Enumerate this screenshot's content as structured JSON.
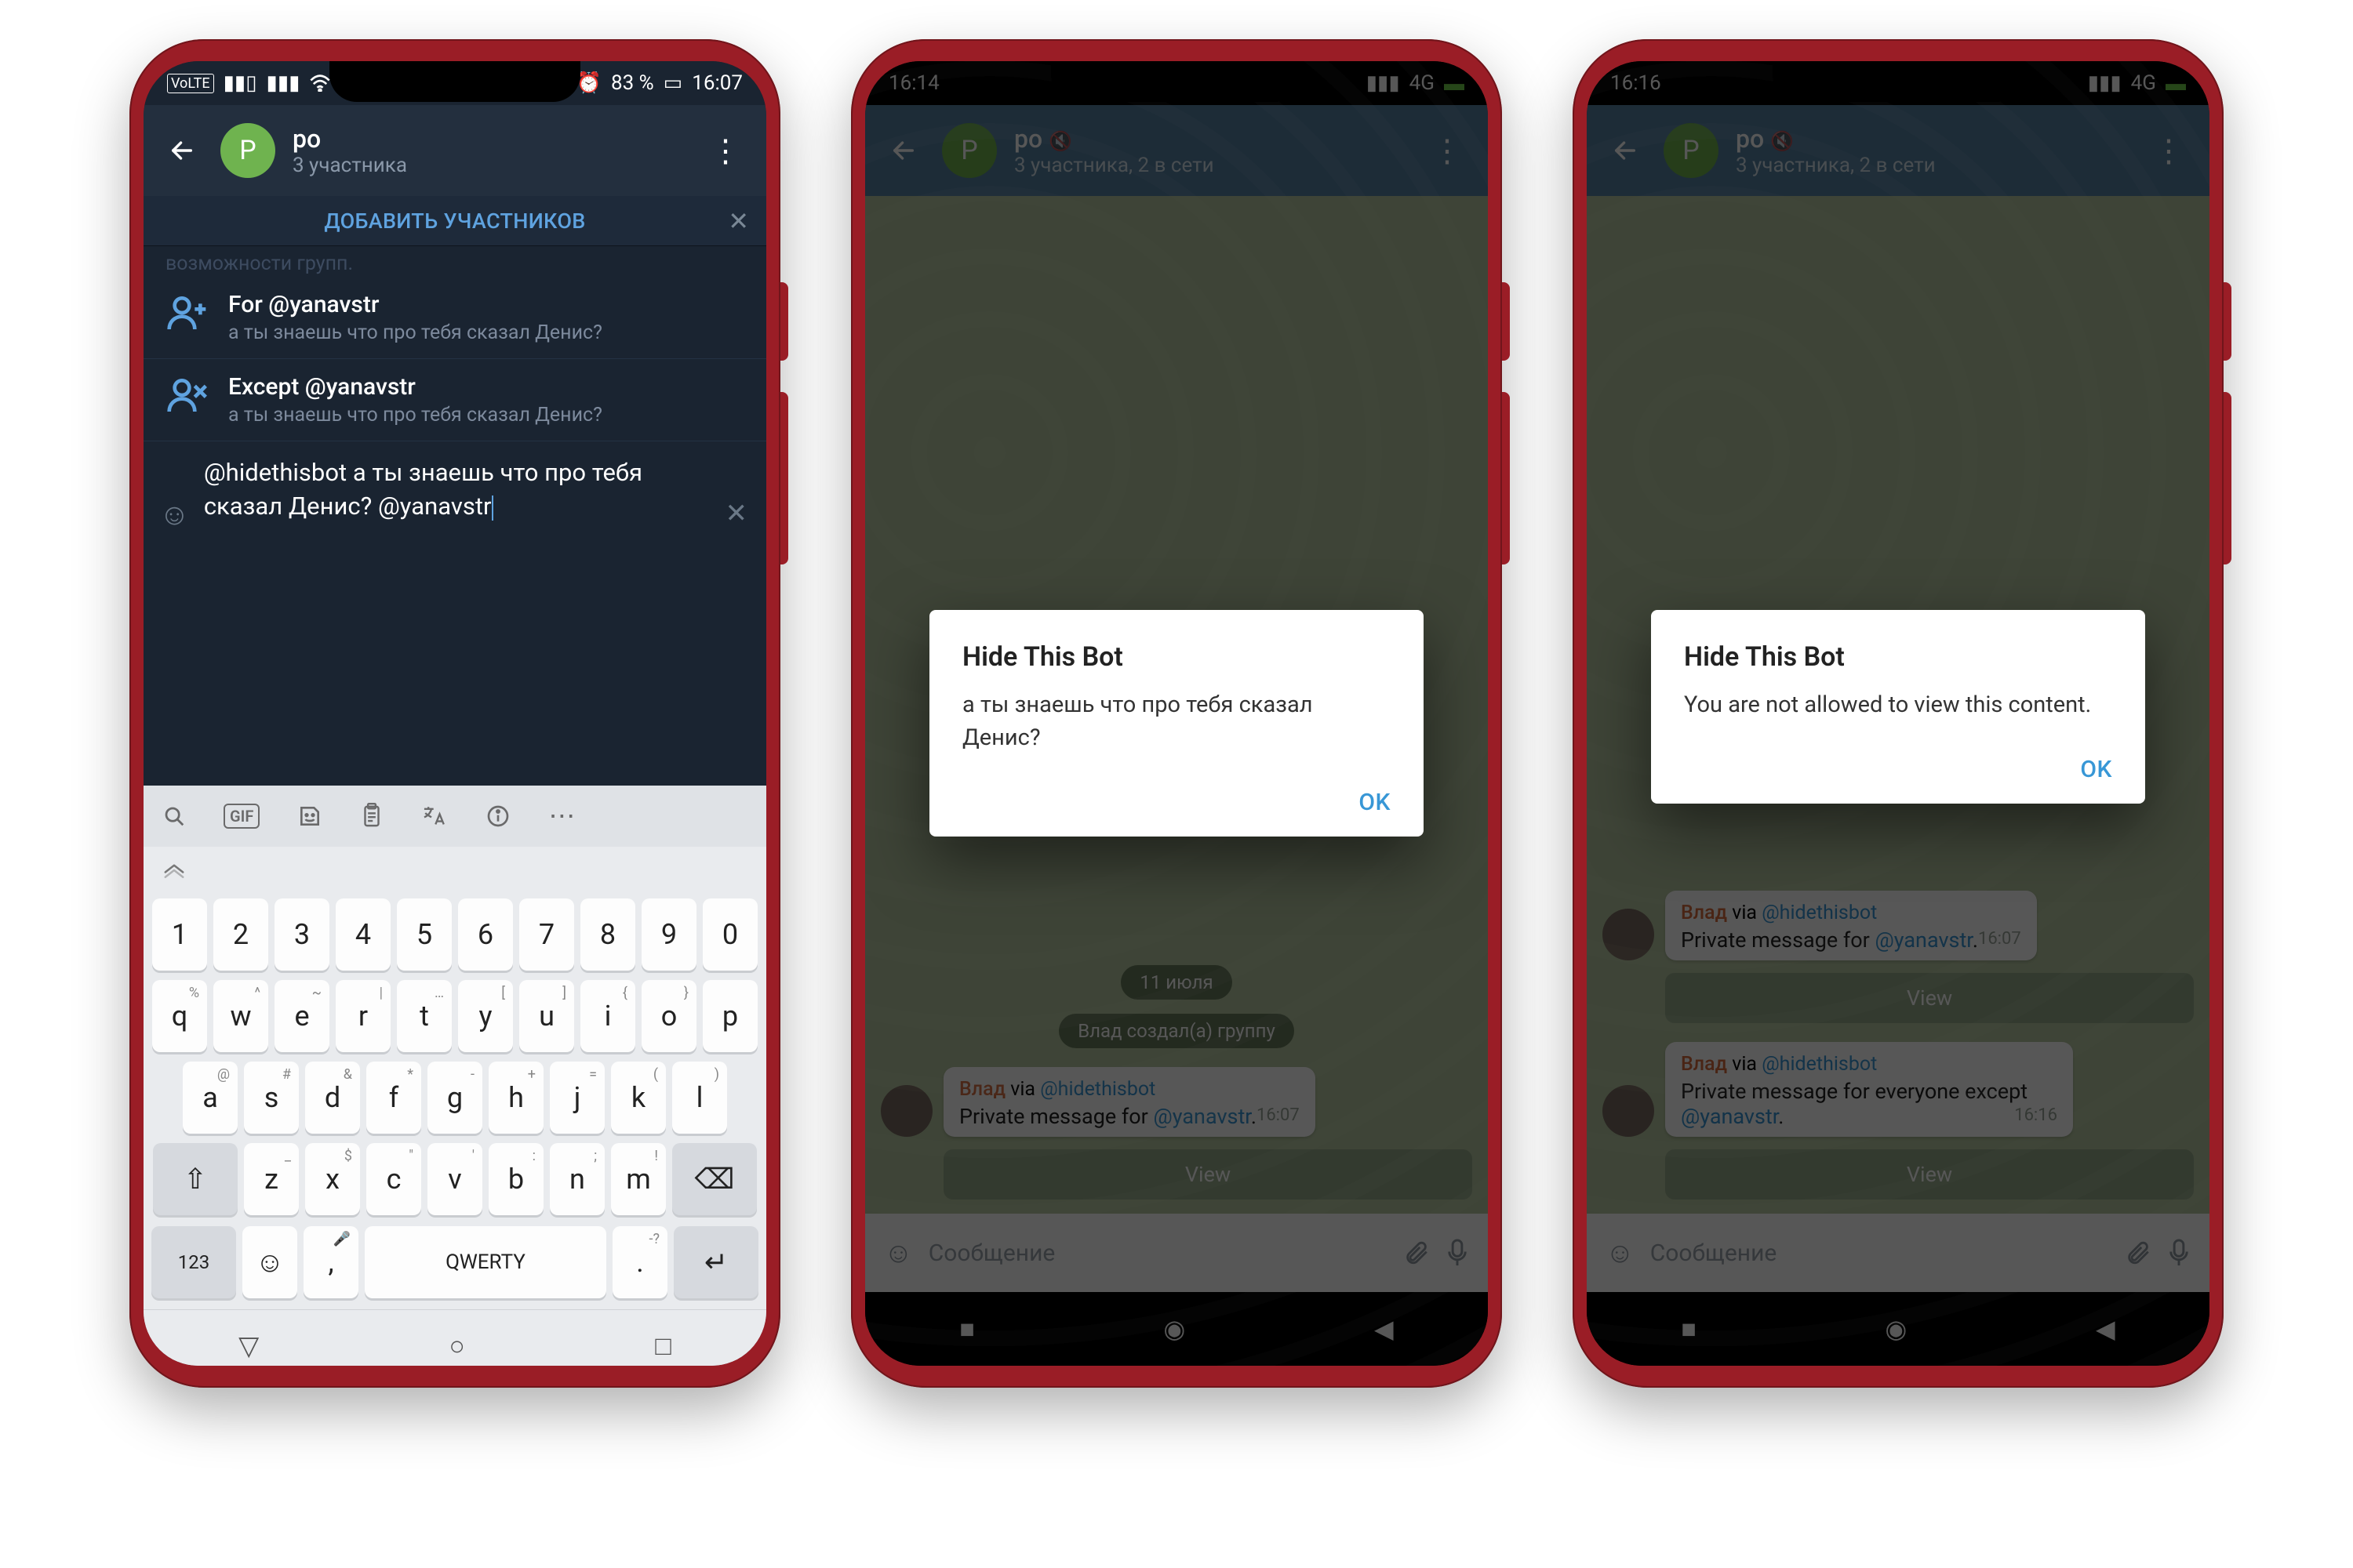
{
  "screen1": {
    "status": {
      "battery": "83 %",
      "time": "16:07"
    },
    "header": {
      "avatar_letter": "P",
      "title": "po",
      "subtitle": "3 участника"
    },
    "banner": {
      "text": "ДОБАВИТЬ УЧАСТНИКОВ"
    },
    "faded": "возможности групп.",
    "suggest": [
      {
        "title": "For @yanavstr",
        "sub": "а ты знаешь что про тебя сказал Денис?"
      },
      {
        "title": "Except @yanavstr",
        "sub": "а ты знаешь что про тебя сказал Денис?"
      }
    ],
    "input_text": "@hidethisbot а ты знаешь что про тебя сказал Денис? @yanavstr",
    "keyboard": {
      "row1": [
        "1",
        "2",
        "3",
        "4",
        "5",
        "6",
        "7",
        "8",
        "9",
        "0"
      ],
      "row2": [
        "q",
        "w",
        "e",
        "r",
        "t",
        "y",
        "u",
        "i",
        "o",
        "p"
      ],
      "row2sup": [
        "%",
        "^",
        "~",
        "|",
        "…",
        "[",
        "]",
        "{",
        "}",
        ""
      ],
      "row3": [
        "a",
        "s",
        "d",
        "f",
        "g",
        "h",
        "j",
        "k",
        "l"
      ],
      "row3sup": [
        "@",
        "#",
        "&",
        "*",
        "-",
        "+",
        "=",
        "(",
        ")"
      ],
      "row4": [
        "z",
        "x",
        "c",
        "v",
        "b",
        "n",
        "m"
      ],
      "row4sup": [
        "_",
        "$",
        "\"",
        "'",
        ":",
        ";",
        "!"
      ],
      "space_label": "QWERTY",
      "numkey": "123"
    }
  },
  "screen2": {
    "status": {
      "time": "16:14",
      "net": "4G"
    },
    "header": {
      "avatar_letter": "P",
      "title": "po",
      "subtitle": "3 участника, 2 в сети"
    },
    "dialog": {
      "title": "Hide This Bot",
      "body": "а ты знаешь что про тебя сказал Денис?",
      "ok": "OK"
    },
    "date_pill": "11 июля",
    "sys_pill": "Влад создал(а) группу",
    "msg": {
      "name": "Влад",
      "via": "via",
      "bot": "@hidethisbot",
      "body_pre": "Private message for ",
      "body_link": "@yanavstr",
      "body_post": ".",
      "time": "16:07"
    },
    "view_btn": "View",
    "composer_placeholder": "Сообщение"
  },
  "screen3": {
    "status": {
      "time": "16:16",
      "net": "4G"
    },
    "header": {
      "avatar_letter": "P",
      "title": "po",
      "subtitle": "3 участника, 2 в сети"
    },
    "dialog": {
      "title": "Hide This Bot",
      "body": "You are not allowed to view this content.",
      "ok": "OK"
    },
    "msgs": [
      {
        "name": "Влад",
        "via": "via",
        "bot": "@hidethisbot",
        "body_pre": "Private message for ",
        "body_link": "@yanavstr",
        "body_post": ".",
        "time": "16:07"
      },
      {
        "name": "Влад",
        "via": "via",
        "bot": "@hidethisbot",
        "body_pre": "Private message for everyone except ",
        "body_link": "@yanavstr",
        "body_post": ".",
        "time": "16:16"
      }
    ],
    "view_btn": "View",
    "composer_placeholder": "Сообщение"
  }
}
